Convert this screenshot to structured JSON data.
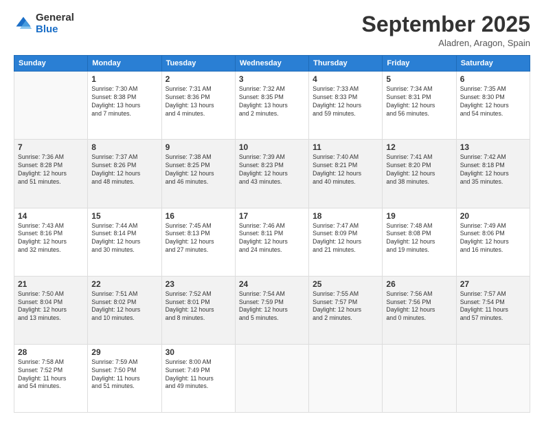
{
  "header": {
    "logo": {
      "general": "General",
      "blue": "Blue"
    },
    "title": "September 2025",
    "location": "Aladren, Aragon, Spain"
  },
  "days_of_week": [
    "Sunday",
    "Monday",
    "Tuesday",
    "Wednesday",
    "Thursday",
    "Friday",
    "Saturday"
  ],
  "weeks": [
    [
      {
        "day": "",
        "info": ""
      },
      {
        "day": "1",
        "info": "Sunrise: 7:30 AM\nSunset: 8:38 PM\nDaylight: 13 hours\nand 7 minutes."
      },
      {
        "day": "2",
        "info": "Sunrise: 7:31 AM\nSunset: 8:36 PM\nDaylight: 13 hours\nand 4 minutes."
      },
      {
        "day": "3",
        "info": "Sunrise: 7:32 AM\nSunset: 8:35 PM\nDaylight: 13 hours\nand 2 minutes."
      },
      {
        "day": "4",
        "info": "Sunrise: 7:33 AM\nSunset: 8:33 PM\nDaylight: 12 hours\nand 59 minutes."
      },
      {
        "day": "5",
        "info": "Sunrise: 7:34 AM\nSunset: 8:31 PM\nDaylight: 12 hours\nand 56 minutes."
      },
      {
        "day": "6",
        "info": "Sunrise: 7:35 AM\nSunset: 8:30 PM\nDaylight: 12 hours\nand 54 minutes."
      }
    ],
    [
      {
        "day": "7",
        "info": "Sunrise: 7:36 AM\nSunset: 8:28 PM\nDaylight: 12 hours\nand 51 minutes."
      },
      {
        "day": "8",
        "info": "Sunrise: 7:37 AM\nSunset: 8:26 PM\nDaylight: 12 hours\nand 48 minutes."
      },
      {
        "day": "9",
        "info": "Sunrise: 7:38 AM\nSunset: 8:25 PM\nDaylight: 12 hours\nand 46 minutes."
      },
      {
        "day": "10",
        "info": "Sunrise: 7:39 AM\nSunset: 8:23 PM\nDaylight: 12 hours\nand 43 minutes."
      },
      {
        "day": "11",
        "info": "Sunrise: 7:40 AM\nSunset: 8:21 PM\nDaylight: 12 hours\nand 40 minutes."
      },
      {
        "day": "12",
        "info": "Sunrise: 7:41 AM\nSunset: 8:20 PM\nDaylight: 12 hours\nand 38 minutes."
      },
      {
        "day": "13",
        "info": "Sunrise: 7:42 AM\nSunset: 8:18 PM\nDaylight: 12 hours\nand 35 minutes."
      }
    ],
    [
      {
        "day": "14",
        "info": "Sunrise: 7:43 AM\nSunset: 8:16 PM\nDaylight: 12 hours\nand 32 minutes."
      },
      {
        "day": "15",
        "info": "Sunrise: 7:44 AM\nSunset: 8:14 PM\nDaylight: 12 hours\nand 30 minutes."
      },
      {
        "day": "16",
        "info": "Sunrise: 7:45 AM\nSunset: 8:13 PM\nDaylight: 12 hours\nand 27 minutes."
      },
      {
        "day": "17",
        "info": "Sunrise: 7:46 AM\nSunset: 8:11 PM\nDaylight: 12 hours\nand 24 minutes."
      },
      {
        "day": "18",
        "info": "Sunrise: 7:47 AM\nSunset: 8:09 PM\nDaylight: 12 hours\nand 21 minutes."
      },
      {
        "day": "19",
        "info": "Sunrise: 7:48 AM\nSunset: 8:08 PM\nDaylight: 12 hours\nand 19 minutes."
      },
      {
        "day": "20",
        "info": "Sunrise: 7:49 AM\nSunset: 8:06 PM\nDaylight: 12 hours\nand 16 minutes."
      }
    ],
    [
      {
        "day": "21",
        "info": "Sunrise: 7:50 AM\nSunset: 8:04 PM\nDaylight: 12 hours\nand 13 minutes."
      },
      {
        "day": "22",
        "info": "Sunrise: 7:51 AM\nSunset: 8:02 PM\nDaylight: 12 hours\nand 10 minutes."
      },
      {
        "day": "23",
        "info": "Sunrise: 7:52 AM\nSunset: 8:01 PM\nDaylight: 12 hours\nand 8 minutes."
      },
      {
        "day": "24",
        "info": "Sunrise: 7:54 AM\nSunset: 7:59 PM\nDaylight: 12 hours\nand 5 minutes."
      },
      {
        "day": "25",
        "info": "Sunrise: 7:55 AM\nSunset: 7:57 PM\nDaylight: 12 hours\nand 2 minutes."
      },
      {
        "day": "26",
        "info": "Sunrise: 7:56 AM\nSunset: 7:56 PM\nDaylight: 12 hours\nand 0 minutes."
      },
      {
        "day": "27",
        "info": "Sunrise: 7:57 AM\nSunset: 7:54 PM\nDaylight: 11 hours\nand 57 minutes."
      }
    ],
    [
      {
        "day": "28",
        "info": "Sunrise: 7:58 AM\nSunset: 7:52 PM\nDaylight: 11 hours\nand 54 minutes."
      },
      {
        "day": "29",
        "info": "Sunrise: 7:59 AM\nSunset: 7:50 PM\nDaylight: 11 hours\nand 51 minutes."
      },
      {
        "day": "30",
        "info": "Sunrise: 8:00 AM\nSunset: 7:49 PM\nDaylight: 11 hours\nand 49 minutes."
      },
      {
        "day": "",
        "info": ""
      },
      {
        "day": "",
        "info": ""
      },
      {
        "day": "",
        "info": ""
      },
      {
        "day": "",
        "info": ""
      }
    ]
  ]
}
